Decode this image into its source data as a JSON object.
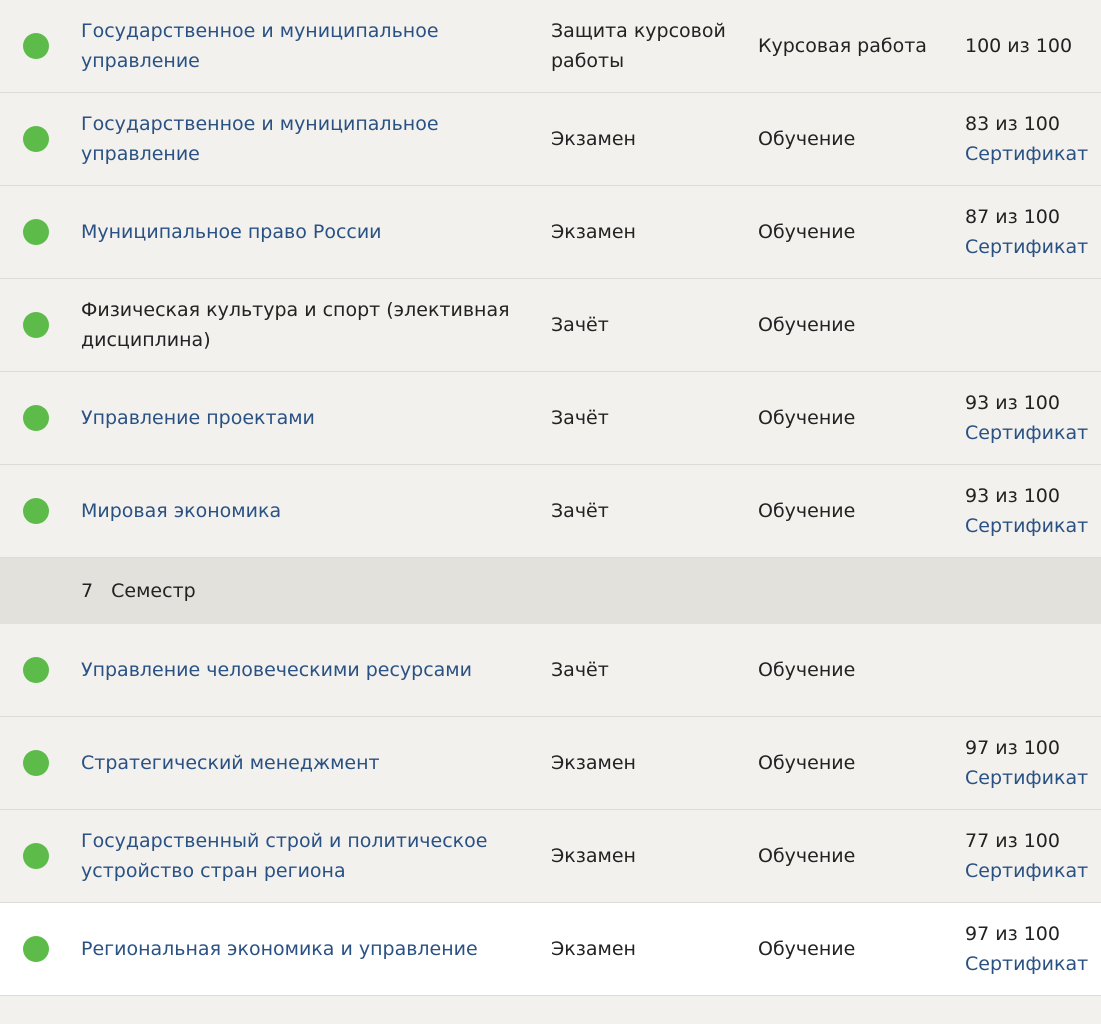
{
  "rows": [
    {
      "name": "Государственное и муниципальное управление",
      "linked": true,
      "type": "Защита курсовой работы",
      "kind": "Курсовая работа",
      "grade": "100 из 100",
      "certificate": ""
    },
    {
      "name": "Государственное и муниципальное управление",
      "linked": true,
      "type": "Экзамен",
      "kind": "Обучение",
      "grade": "83 из 100",
      "certificate": "Сертификат"
    },
    {
      "name": "Муниципальное право России",
      "linked": true,
      "type": "Экзамен",
      "kind": "Обучение",
      "grade": "87 из 100",
      "certificate": "Сертификат"
    },
    {
      "name": "Физическая культура и спорт (элективная дисциплина)",
      "linked": false,
      "type": "Зачёт",
      "kind": "Обучение",
      "grade": "",
      "certificate": ""
    },
    {
      "name": "Управление проектами",
      "linked": true,
      "type": "Зачёт",
      "kind": "Обучение",
      "grade": "93 из 100",
      "certificate": "Сертификат"
    },
    {
      "name": "Мировая экономика",
      "linked": true,
      "type": "Зачёт",
      "kind": "Обучение",
      "grade": "93 из 100",
      "certificate": "Сертификат"
    }
  ],
  "semester": {
    "number": "7",
    "label": "Семестр"
  },
  "rows2": [
    {
      "name": "Управление человеческими ресурсами",
      "linked": true,
      "type": "Зачёт",
      "kind": "Обучение",
      "grade": "",
      "certificate": ""
    },
    {
      "name": "Стратегический менеджмент",
      "linked": true,
      "type": "Экзамен",
      "kind": "Обучение",
      "grade": "97 из 100",
      "certificate": "Сертификат"
    },
    {
      "name": "Государственный строй и политическое устройство стран региона",
      "linked": true,
      "type": "Экзамен",
      "kind": "Обучение",
      "grade": "77 из 100",
      "certificate": "Сертификат"
    },
    {
      "name": "Региональная экономика и управление",
      "linked": true,
      "type": "Экзамен",
      "kind": "Обучение",
      "grade": "97 из 100",
      "certificate": "Сертификат"
    }
  ],
  "colors": {
    "status_dot": "#5dbb4a",
    "link": "#2a5183"
  }
}
